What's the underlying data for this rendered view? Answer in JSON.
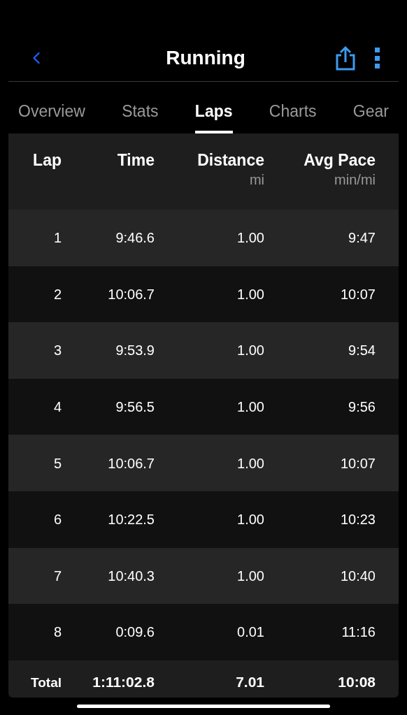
{
  "title": "Running",
  "tabs": [
    {
      "label": "Overview",
      "selected": false
    },
    {
      "label": "Stats",
      "selected": false
    },
    {
      "label": "Laps",
      "selected": true
    },
    {
      "label": "Charts",
      "selected": false
    },
    {
      "label": "Gear",
      "selected": false
    }
  ],
  "table": {
    "columns": [
      {
        "label": "Lap"
      },
      {
        "label": "Time"
      },
      {
        "label": "Distance",
        "unit": "mi"
      },
      {
        "label": "Avg Pace",
        "unit": "min/mi"
      }
    ],
    "rows": [
      [
        "1",
        "9:46.6",
        "1.00",
        "9:47"
      ],
      [
        "2",
        "10:06.7",
        "1.00",
        "10:07"
      ],
      [
        "3",
        "9:53.9",
        "1.00",
        "9:54"
      ],
      [
        "4",
        "9:56.5",
        "1.00",
        "9:56"
      ],
      [
        "5",
        "10:06.7",
        "1.00",
        "10:07"
      ],
      [
        "6",
        "10:22.5",
        "1.00",
        "10:23"
      ],
      [
        "7",
        "10:40.3",
        "1.00",
        "10:40"
      ],
      [
        "8",
        "0:09.6",
        "0.01",
        "11:16"
      ]
    ],
    "total": [
      "Total",
      "1:11:02.8",
      "7.01",
      "10:08"
    ]
  }
}
